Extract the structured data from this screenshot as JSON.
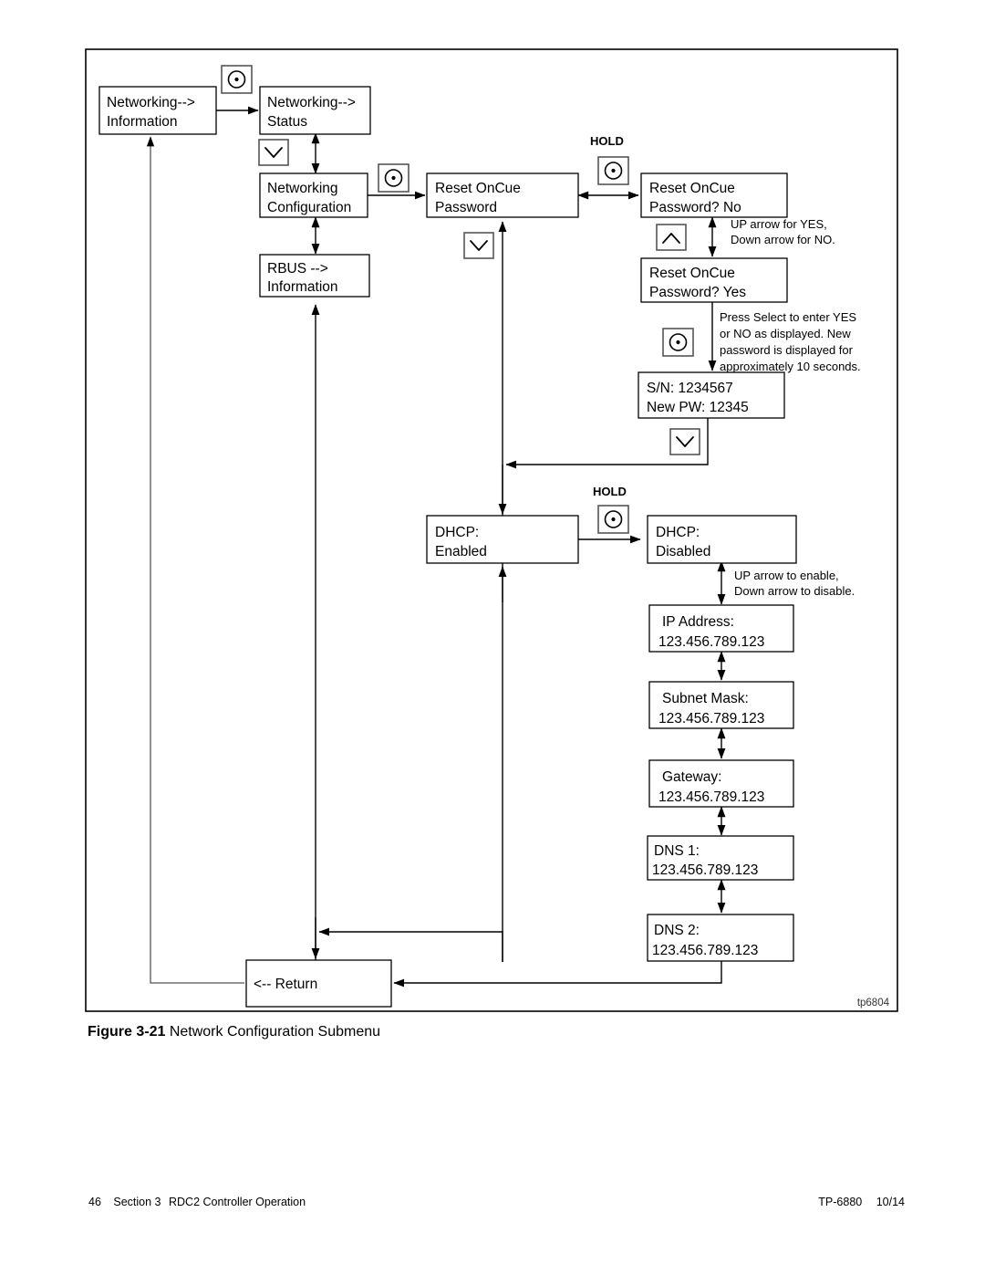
{
  "figure": {
    "caption_label": "Figure 3-21",
    "caption_title": "Network Configuration Submenu",
    "art_tag": "tp6804"
  },
  "footer": {
    "page_number": "46",
    "section": "Section 3",
    "section_title": "RDC2 Controller Operation",
    "document_number": "TP-6880",
    "revision": "10/14"
  },
  "boxes": {
    "networking_information": {
      "line1": "Networking-->",
      "line2": "Information"
    },
    "networking_status": {
      "line1": "Networking-->",
      "line2": "Status"
    },
    "networking_configuration": {
      "line1": "Networking",
      "line2": "Configuration"
    },
    "rbus_information": {
      "line1": "RBUS    -->",
      "line2": "Information"
    },
    "reset_oncue_password": {
      "line1": "Reset OnCue",
      "line2": "Password"
    },
    "reset_oncue_password_no": {
      "line1": "Reset OnCue",
      "line2": "Password? No"
    },
    "reset_oncue_password_yes": {
      "line1": "Reset OnCue",
      "line2": "Password? Yes"
    },
    "serial_new_password": {
      "line1": "S/N: 1234567",
      "line2": "New PW: 12345"
    },
    "dhcp_enabled": {
      "line1": "DHCP:",
      "line2": "Enabled"
    },
    "dhcp_disabled": {
      "line1": "DHCP:",
      "line2": "Disabled"
    },
    "ip_address": {
      "line1": "IP Address:",
      "line2": "123.456.789.123"
    },
    "subnet_mask": {
      "line1": "Subnet Mask:",
      "line2": "123.456.789.123"
    },
    "gateway": {
      "line1": "Gateway:",
      "line2": "123.456.789.123"
    },
    "dns_1": {
      "line1": "DNS 1:",
      "line2": "123.456.789.123"
    },
    "dns_2": {
      "line1": "DNS 2:",
      "line2": "123.456.789.123"
    },
    "return_box": {
      "line1": "<-- Return"
    }
  },
  "labels": {
    "hold_password": "HOLD",
    "hold_dhcp": "HOLD",
    "yes_no_note_line1": "UP arrow for YES,",
    "yes_no_note_line2": "Down arrow for NO.",
    "select_note_line1": "Press Select to enter YES",
    "select_note_line2": "or NO as displayed. New",
    "select_note_line3": "password is displayed for",
    "select_note_line4": "approximately 10 seconds.",
    "dhcp_note_line1": "UP arrow to enable,",
    "dhcp_note_line2": "Down arrow to disable."
  },
  "icons": {
    "select_button": "select-button-icon",
    "down_arrow_button": "down-arrow-button-icon",
    "up_arrow_button": "up-arrow-button-icon"
  },
  "colors": {
    "line": "#000000",
    "box_stroke": "#000000",
    "button_stroke": "#555555",
    "background": "#ffffff"
  }
}
